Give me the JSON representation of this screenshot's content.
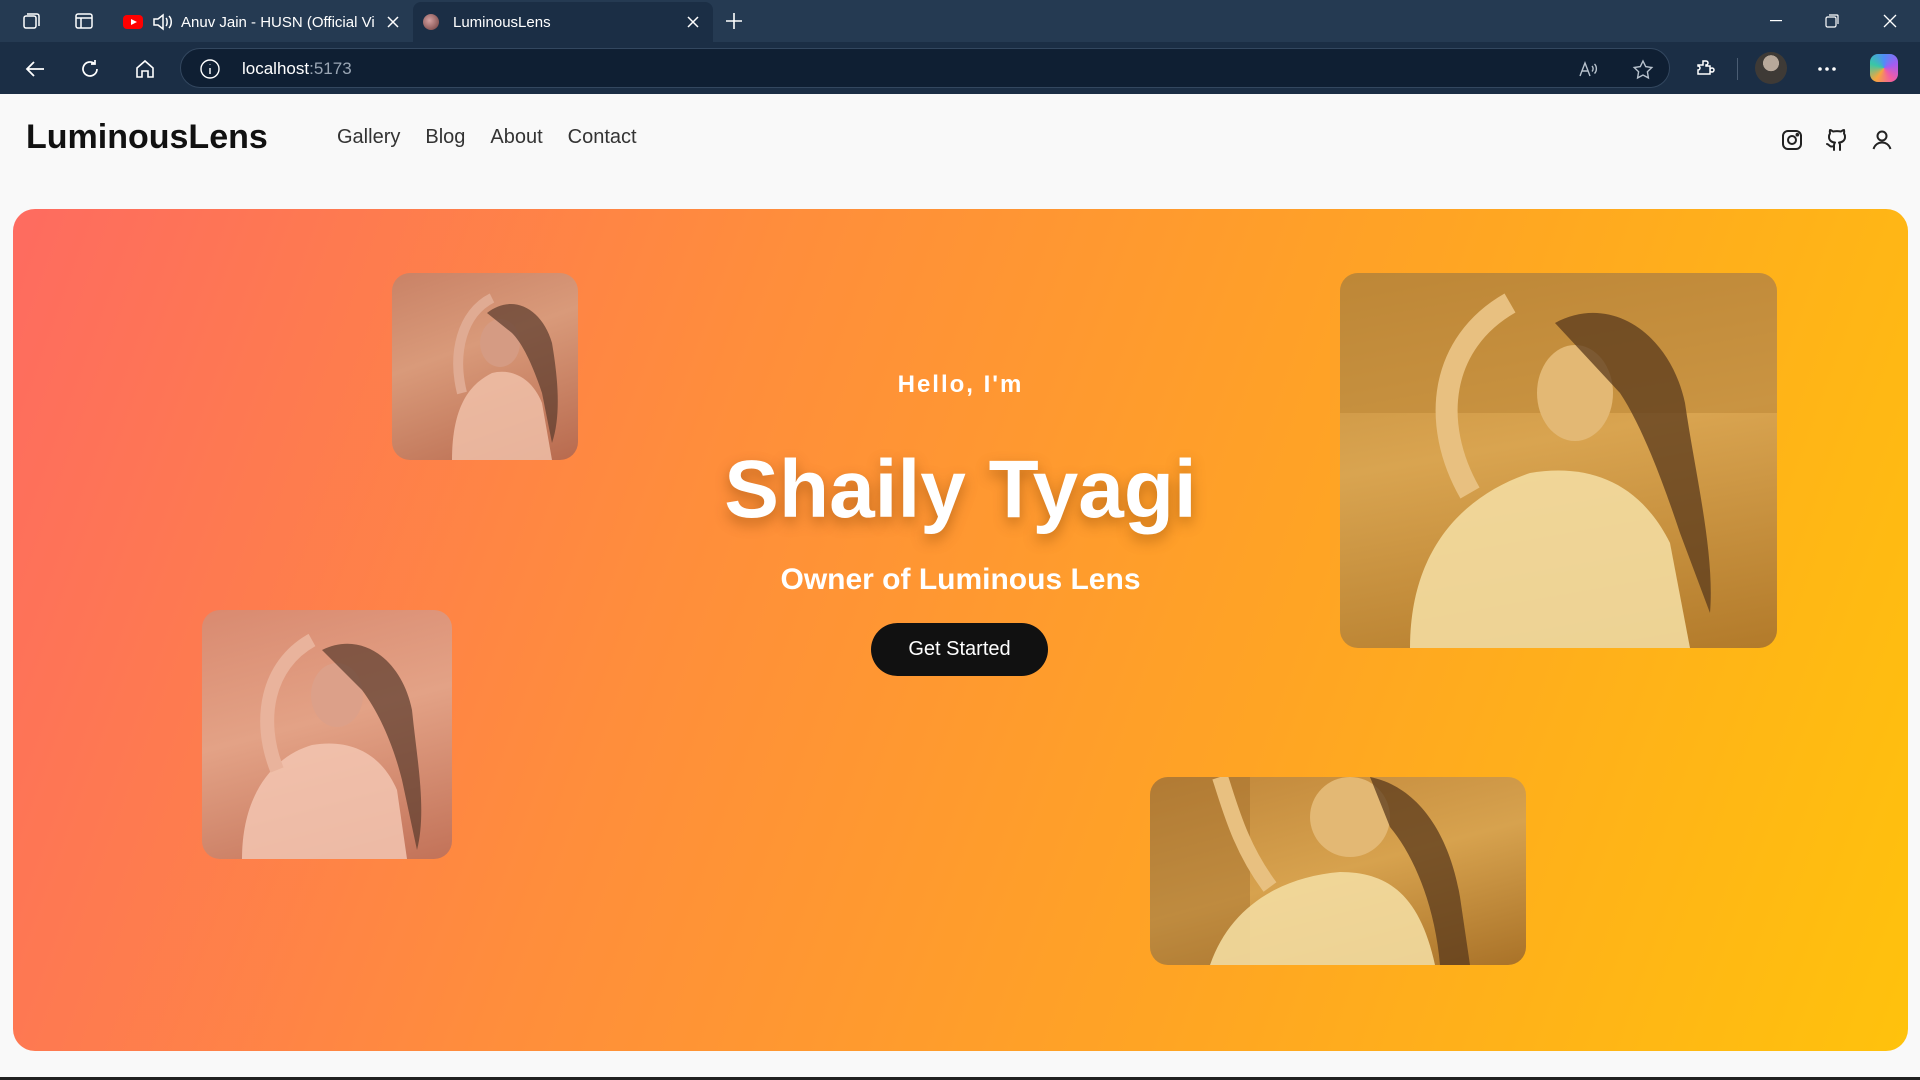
{
  "browser": {
    "tabs": [
      {
        "title": "Anuv Jain - HUSN (Official Vi",
        "favicon": "youtube-icon",
        "audio": "speaker-icon"
      },
      {
        "title": "LuminousLens",
        "favicon": "lens-favicon",
        "active": true
      }
    ],
    "url": {
      "host": "localhost",
      "port": ":5173"
    }
  },
  "site": {
    "brand": "LuminousLens",
    "nav": [
      "Gallery",
      "Blog",
      "About",
      "Contact"
    ],
    "social_icons": [
      "instagram-icon",
      "github-icon",
      "user-icon"
    ]
  },
  "hero": {
    "greeting": "Hello, I'm",
    "name": "Shaily Tyagi",
    "role": "Owner of Luminous Lens",
    "cta": "Get Started",
    "gradient": [
      "#fe6b60",
      "#ffc20c"
    ]
  },
  "colors": {
    "chrome_tabbar": "#253a52",
    "chrome_toolbar": "#1b2e45",
    "button_dark": "#111111"
  }
}
